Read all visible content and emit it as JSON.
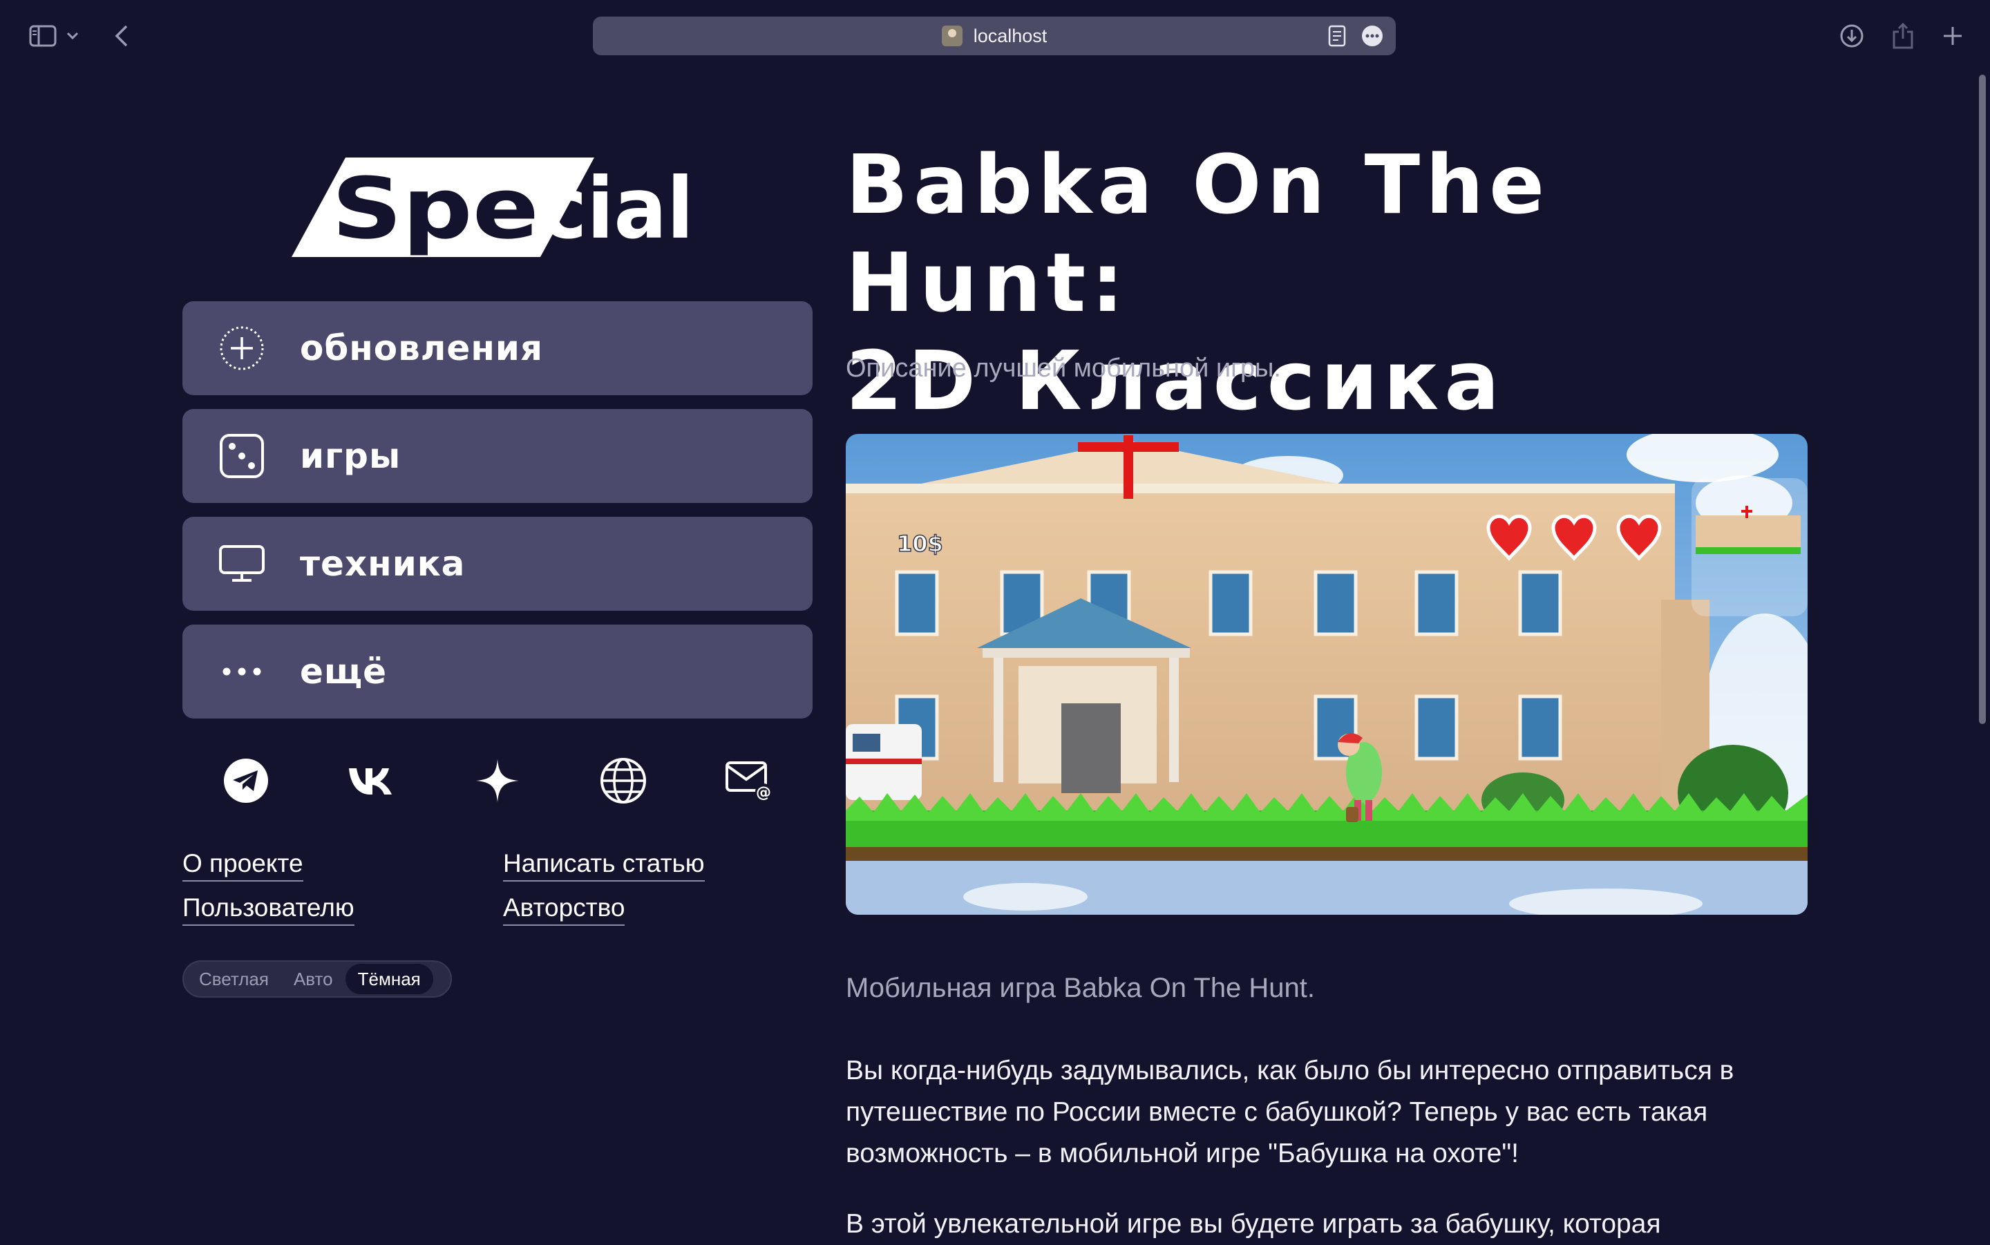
{
  "browser": {
    "url": "localhost",
    "icons": [
      "sidebar-icon",
      "chevron-down-icon",
      "back-icon",
      "reader-icon",
      "more-icon",
      "download-icon",
      "share-icon",
      "new-tab-icon"
    ]
  },
  "site": {
    "logo_text": "Special"
  },
  "nav": {
    "items": [
      {
        "label": "обновления",
        "icon": "plus-circle-icon"
      },
      {
        "label": "игры",
        "icon": "dice-icon"
      },
      {
        "label": "техника",
        "icon": "monitor-icon"
      },
      {
        "label": "ещё",
        "icon": "more-dots-icon"
      }
    ]
  },
  "socials": [
    "telegram-icon",
    "vk-icon",
    "sparkle-icon",
    "globe-icon",
    "mail-icon"
  ],
  "footer_links": {
    "about": "О проекте",
    "write": "Написать статью",
    "user": "Пользователю",
    "authorship": "Авторство"
  },
  "theme": {
    "options": [
      "Светлая",
      "Авто",
      "Тёмная"
    ],
    "selected": "Тёмная"
  },
  "article": {
    "title_line1": "Babka On The Hunt:",
    "title_line2": "2D Классика",
    "subtitle": "Описание лучшей мобильной игры.",
    "game_hud": {
      "money": "10$",
      "lives": 3
    },
    "caption": "Мобильная игра Babka On The Hunt.",
    "paragraph1": "Вы когда-нибудь задумывались, как было бы интересно отправиться в путешествие по России вместе с бабушкой? Теперь у вас есть такая возможность – в мобильной игре \"Бабушка на охоте\"!",
    "paragraph2": "В этой увлекательной игре вы будете играть за бабушку, которая"
  },
  "colors": {
    "background": "#13132d",
    "nav_item": "#4c4a6c",
    "address_bar": "#4b4b66",
    "muted_text": "#a9a9bd"
  }
}
